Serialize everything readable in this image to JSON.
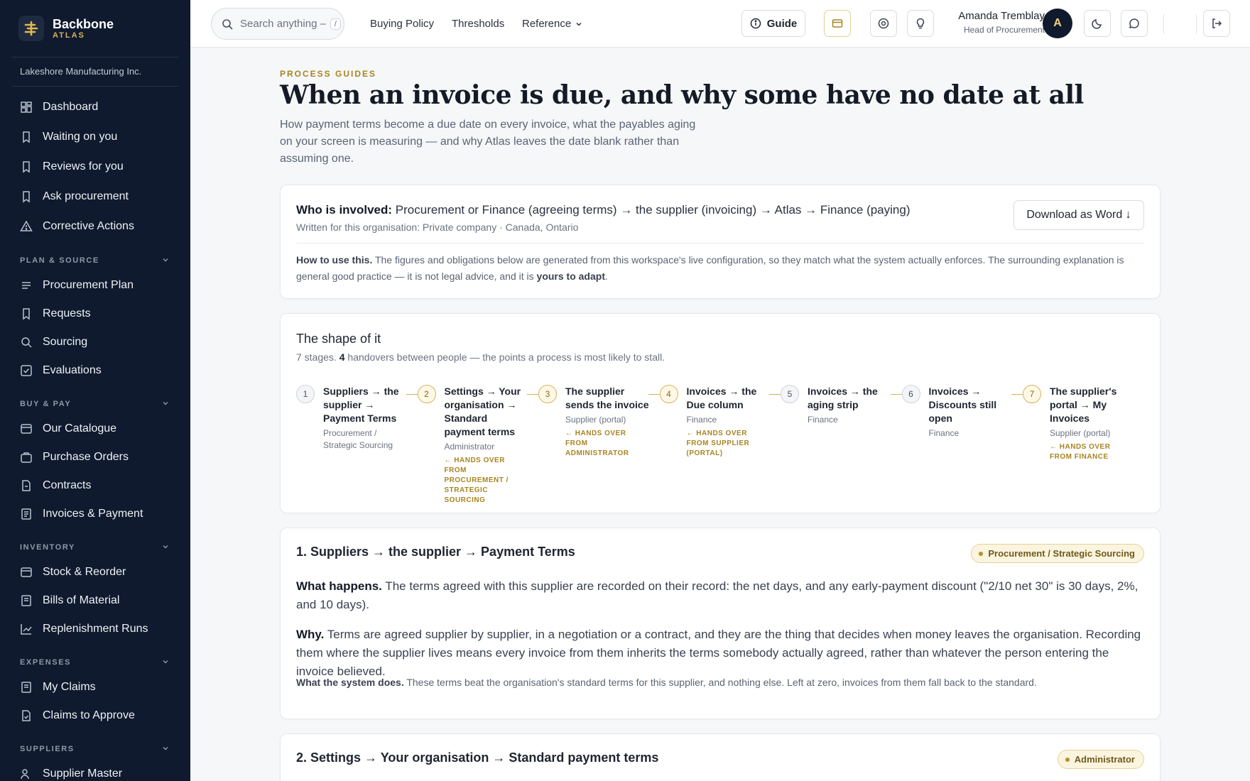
{
  "brand": {
    "name": "Backbone",
    "sub": "ATLAS"
  },
  "org": "Lakeshore Manufacturing Inc.",
  "sidebar": {
    "top_items": [
      {
        "label": "Dashboard",
        "icon": "dashboard-icon"
      },
      {
        "label": "Waiting on you",
        "icon": "bookmark-icon"
      },
      {
        "label": "Reviews for you",
        "icon": "bookmark-icon"
      },
      {
        "label": "Ask procurement",
        "icon": "bookmark-icon"
      },
      {
        "label": "Corrective Actions",
        "icon": "warning-icon"
      }
    ],
    "sections": [
      {
        "label": "PLAN & SOURCE",
        "items": [
          "Procurement Plan",
          "Requests",
          "Sourcing",
          "Evaluations"
        ]
      },
      {
        "label": "BUY & PAY",
        "items": [
          "Our Catalogue",
          "Purchase Orders",
          "Contracts",
          "Invoices & Payment"
        ]
      },
      {
        "label": "INVENTORY",
        "items": [
          "Stock & Reorder",
          "Bills of Material",
          "Replenishment Runs"
        ]
      },
      {
        "label": "EXPENSES",
        "items": [
          "My Claims",
          "Claims to Approve"
        ]
      },
      {
        "label": "SUPPLIERS",
        "items": [
          "Supplier Master"
        ]
      }
    ]
  },
  "topbar": {
    "search_placeholder": "Search anything –",
    "search_kbd": "/",
    "nav": [
      "Buying Policy",
      "Thresholds",
      "Reference"
    ],
    "guide": "Guide",
    "user_name": "Amanda Tremblay",
    "user_role": "Head of Procurement",
    "avatar": "A"
  },
  "page": {
    "eyebrow": "PROCESS GUIDES",
    "title": "When an invoice is due, and why some have no date at all",
    "subtitle": "How payment terms become a due date on every invoice, what the payables aging on your screen is measuring — and why Atlas leaves the date blank rather than assuming one."
  },
  "info": {
    "involved_label": "Who is involved:",
    "involved": "Procurement or Finance (agreeing terms) → the supplier (invoicing) → Atlas → Finance (paying)",
    "written": "Written for this organisation: Private company · Canada, Ontario",
    "download": "Download as Word ↓",
    "howto_label": "How to use this.",
    "howto": "The figures and obligations below are generated from this workspace's live configuration, so they match what the system actually enforces. The surrounding explanation is general good practice — it is not legal advice, and it is",
    "howto_bold": "yours to adapt",
    "howto_end": "."
  },
  "shape": {
    "title": "The shape of it",
    "sub_pre": "7 stages.",
    "sub_count": "4",
    "sub_post": "handovers between people — the points a process is most likely to stall.",
    "stages": [
      {
        "n": "1",
        "title": "Suppliers → the supplier → Payment Terms",
        "role": "Procurement / Strategic Sourcing",
        "handover": ""
      },
      {
        "n": "2",
        "title": "Settings → Your organisation → Standard payment terms",
        "role": "Administrator",
        "handover": "← HANDS OVER FROM PROCUREMENT / STRATEGIC SOURCING"
      },
      {
        "n": "3",
        "title": "The supplier sends the invoice",
        "role": "Supplier (portal)",
        "handover": "← HANDS OVER FROM ADMINISTRATOR"
      },
      {
        "n": "4",
        "title": "Invoices → the Due column",
        "role": "Finance",
        "handover": "← HANDS OVER FROM SUPPLIER (PORTAL)"
      },
      {
        "n": "5",
        "title": "Invoices → the aging strip",
        "role": "Finance",
        "handover": ""
      },
      {
        "n": "6",
        "title": "Invoices → Discounts still open",
        "role": "Finance",
        "handover": ""
      },
      {
        "n": "7",
        "title": "The supplier's portal → My Invoices",
        "role": "Supplier (portal)",
        "handover": "← HANDS OVER FROM FINANCE"
      }
    ]
  },
  "section1": {
    "title": "1. Suppliers → the supplier → Payment Terms",
    "pill": "Procurement / Strategic Sourcing",
    "what_label": "What happens.",
    "what": "The terms agreed with this supplier are recorded on their record: the net days, and any early-payment discount (\"2/10 net 30\" is 30 days, 2%, and 10 days).",
    "why_label": "Why.",
    "why": "Terms are agreed supplier by supplier, in a negotiation or a contract, and they are the thing that decides when money leaves the organisation. Recording them where the supplier lives means every invoice from them inherits the terms somebody actually agreed, rather than whatever the person entering the invoice believed.",
    "system_label": "What the system does.",
    "system": "These terms beat the organisation's standard terms for this supplier, and nothing else. Left at zero, invoices from them fall back to the standard."
  },
  "section2": {
    "title": "2. Settings → Your organisation → Standard payment terms",
    "pill": "Administrator"
  },
  "colors": {
    "sidebar": "#0f1a2e",
    "accent": "#d7b25a",
    "eyebrow": "#a88420"
  }
}
